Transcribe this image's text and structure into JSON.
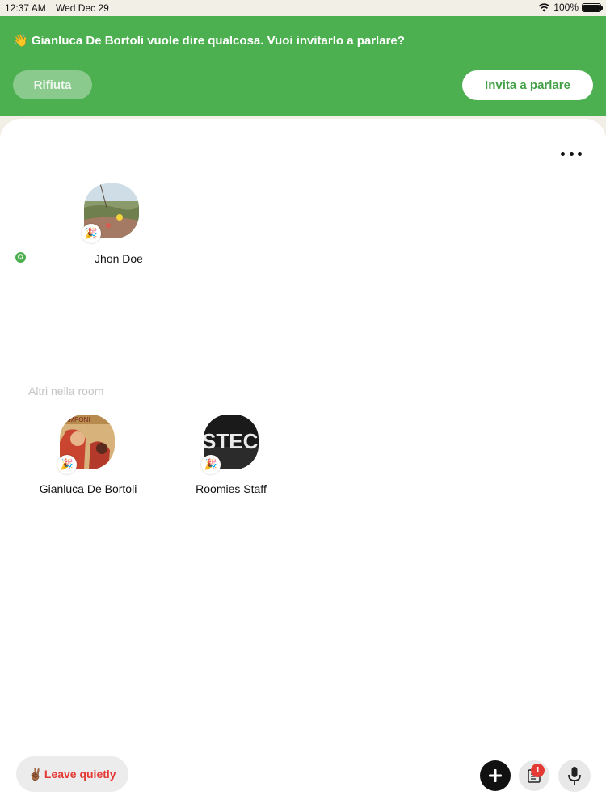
{
  "status_bar": {
    "time": "12:37 AM",
    "date": "Wed Dec 29",
    "battery": "100%"
  },
  "banner": {
    "message": "👋 Gianluca De Bortoli vuole dire qualcosa. Vuoi invitarlo a parlare?",
    "reject_label": "Rifiuta",
    "invite_label": "Invita a parlare",
    "color": "#4caf50"
  },
  "speakers": [
    {
      "name": "Jhon Doe",
      "badge": "🎉"
    }
  ],
  "audience": {
    "label": "Altri nella room",
    "members": [
      {
        "name": "Gianluca De Bortoli",
        "badge": "🎉"
      },
      {
        "name": "Roomies Staff",
        "badge": "🎉"
      }
    ]
  },
  "footer": {
    "leave_emoji": "✌🏾",
    "leave_label": "Leave quietly",
    "notification_count": "1"
  }
}
